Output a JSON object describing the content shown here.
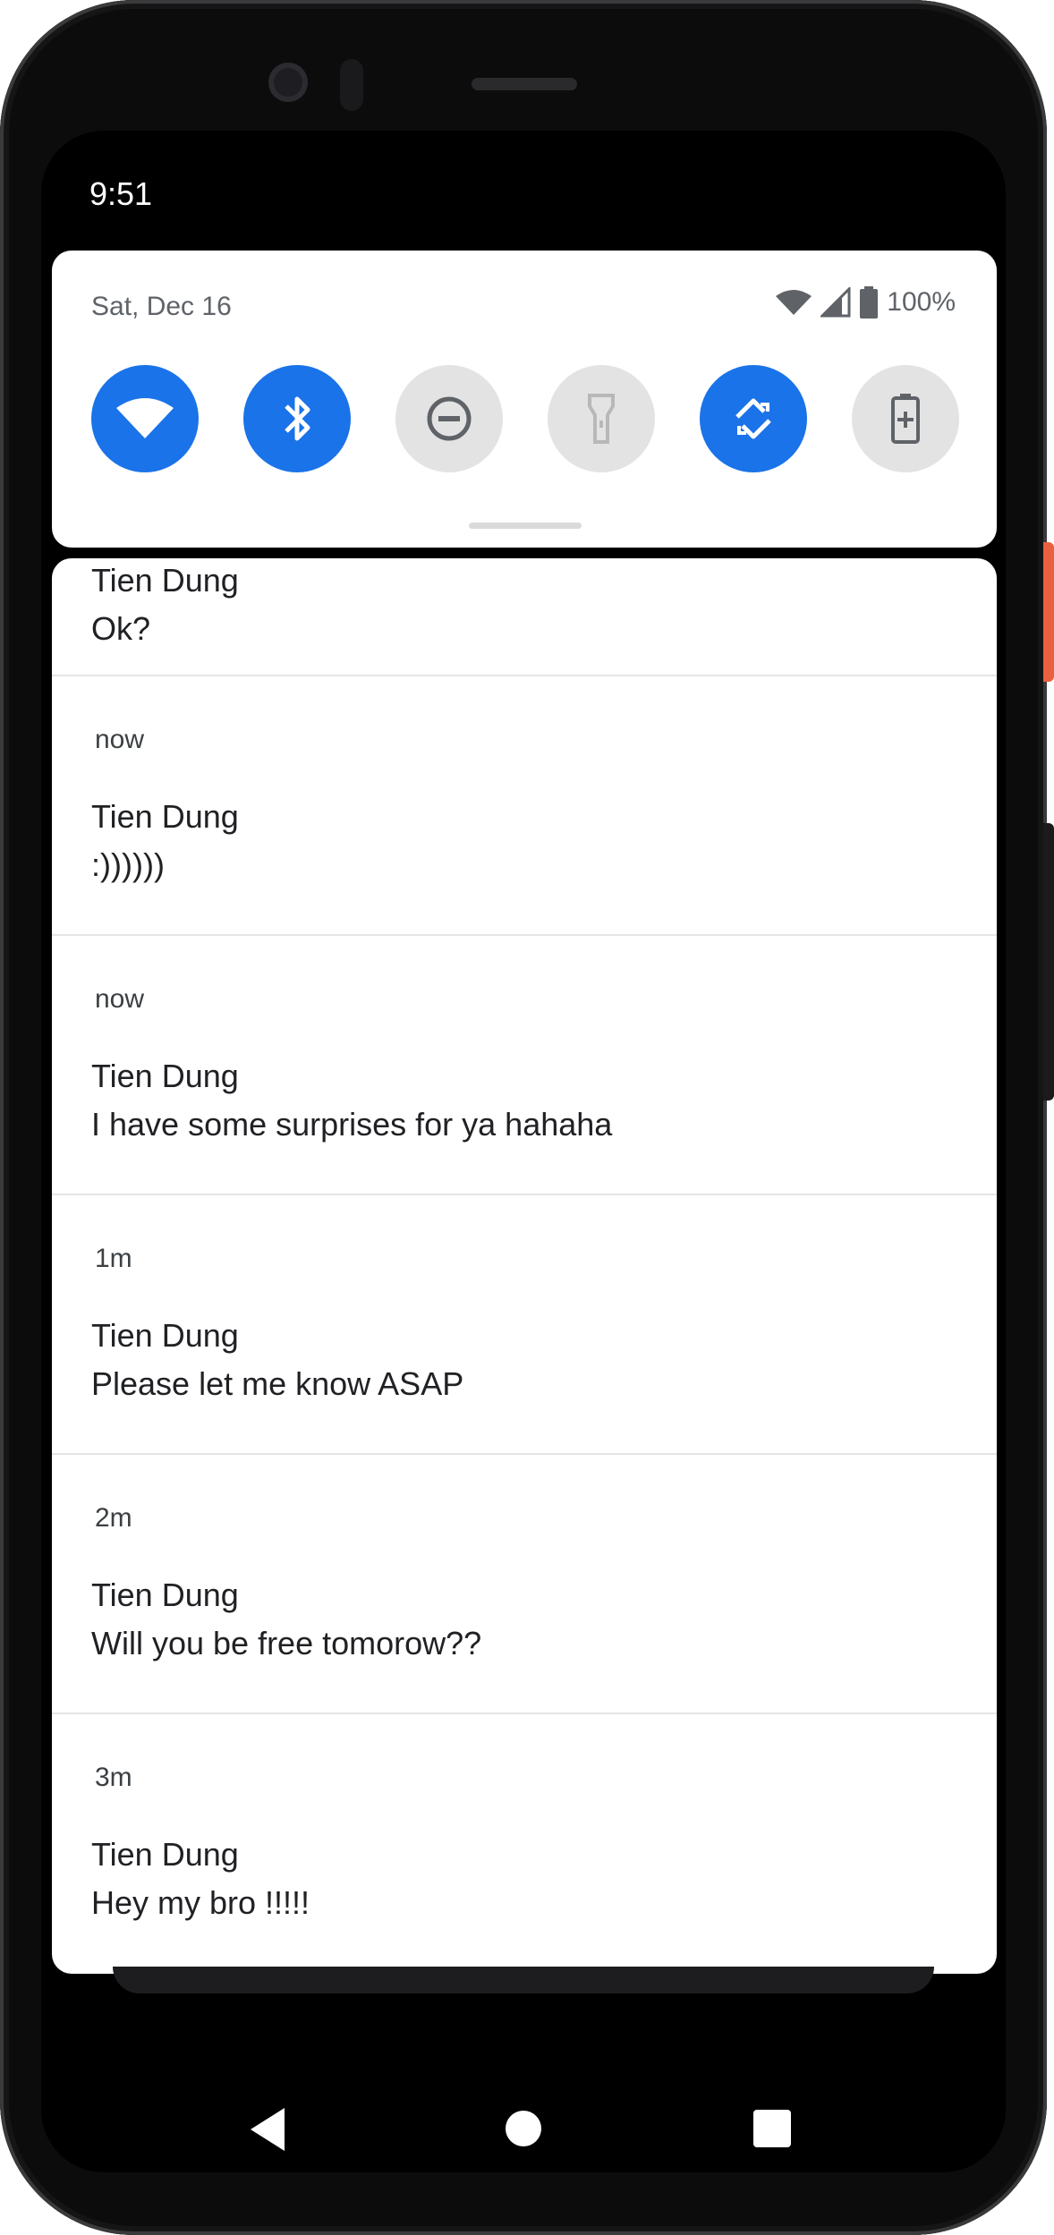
{
  "status_bar": {
    "time": "9:51"
  },
  "quick_settings": {
    "date": "Sat, Dec 16",
    "battery": "100%",
    "tiles": [
      {
        "name": "wifi-icon",
        "state": "on"
      },
      {
        "name": "bluetooth-icon",
        "state": "on"
      },
      {
        "name": "do-not-disturb-icon",
        "state": "off"
      },
      {
        "name": "flashlight-icon",
        "state": "off"
      },
      {
        "name": "auto-rotate-icon",
        "state": "on"
      },
      {
        "name": "battery-saver-icon",
        "state": "off"
      }
    ]
  },
  "notifications": [
    {
      "time": "",
      "sender": "Tien Dung",
      "message": "Ok?"
    },
    {
      "time": "now",
      "sender": "Tien Dung",
      "message": ":))))))"
    },
    {
      "time": "now",
      "sender": "Tien Dung",
      "message": "I have some surprises for ya hahaha"
    },
    {
      "time": "1m",
      "sender": "Tien Dung",
      "message": "Please let me know ASAP"
    },
    {
      "time": "2m",
      "sender": "Tien Dung",
      "message": "Will you be free tomorow??"
    },
    {
      "time": "3m",
      "sender": "Tien Dung",
      "message": "Hey my bro !!!!!"
    }
  ],
  "colors": {
    "accent": "#1a73e8",
    "tile_off": "#e3e3e3",
    "text": "#202124"
  }
}
